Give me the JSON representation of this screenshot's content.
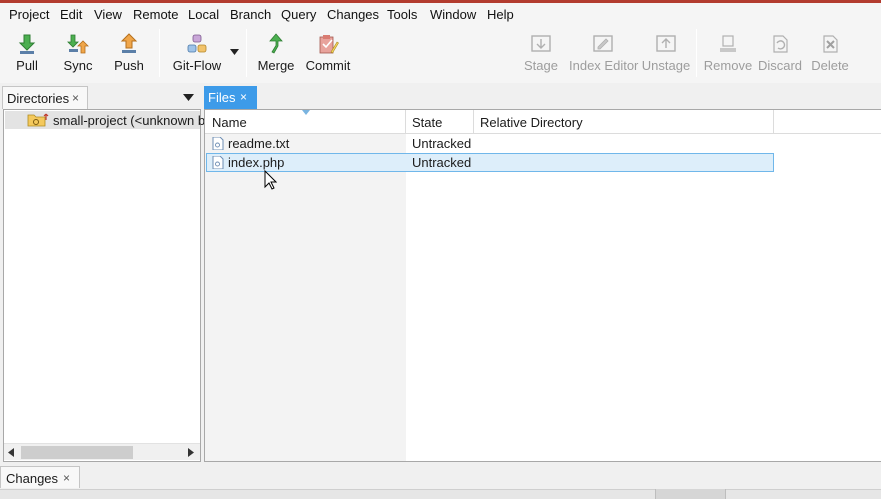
{
  "menubar": {
    "items": [
      "Project",
      "Edit",
      "View",
      "Remote",
      "Local",
      "Branch",
      "Query",
      "Changes",
      "Tools",
      "Window",
      "Help"
    ]
  },
  "toolbar": {
    "pull": "Pull",
    "sync": "Sync",
    "push": "Push",
    "gitflow": "Git-Flow",
    "merge": "Merge",
    "commit": "Commit",
    "stage": "Stage",
    "index_editor": "Index Editor",
    "unstage": "Unstage",
    "remove": "Remove",
    "discard": "Discard",
    "delete": "Delete"
  },
  "directories": {
    "tab_label": "Directories",
    "close": "×",
    "root_label": "small-project (<unknown b"
  },
  "files": {
    "tab_label": "Files",
    "close": "×",
    "columns": [
      "Name",
      "State",
      "Relative Directory"
    ],
    "rows": [
      {
        "name": "readme.txt",
        "state": "Untracked",
        "dir": ""
      },
      {
        "name": "index.php",
        "state": "Untracked",
        "dir": ""
      }
    ]
  },
  "changes": {
    "tab_label": "Changes",
    "close": "×"
  },
  "colors": {
    "accent_tab": "#3d9be9",
    "selection_bg": "#ddeefa",
    "selection_border": "#70b7ea",
    "title_accent": "#b33c2f"
  }
}
